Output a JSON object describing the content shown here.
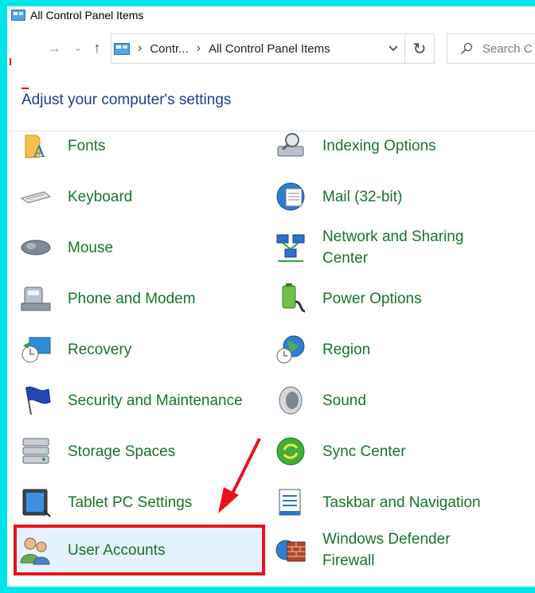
{
  "window": {
    "title": "All Control Panel Items"
  },
  "address_bar": {
    "crumbs": [
      "Contr...",
      "All Control Panel Items"
    ]
  },
  "search": {
    "placeholder": "Search C"
  },
  "heading": "Adjust your computer's settings",
  "items_left": [
    {
      "label": "Fonts",
      "icon": "fonts-icon"
    },
    {
      "label": "Keyboard",
      "icon": "keyboard-icon"
    },
    {
      "label": "Mouse",
      "icon": "mouse-icon"
    },
    {
      "label": "Phone and Modem",
      "icon": "phone-modem-icon"
    },
    {
      "label": "Recovery",
      "icon": "recovery-icon"
    },
    {
      "label": "Security and Maintenance",
      "icon": "security-flag-icon"
    },
    {
      "label": "Storage Spaces",
      "icon": "storage-spaces-icon"
    },
    {
      "label": "Tablet PC Settings",
      "icon": "tablet-pc-icon"
    },
    {
      "label": "User Accounts",
      "icon": "user-accounts-icon"
    }
  ],
  "items_right": [
    {
      "label": "Indexing Options",
      "icon": "indexing-icon"
    },
    {
      "label": "Mail (32-bit)",
      "icon": "mail-icon"
    },
    {
      "label_line1": "Network and Sharing",
      "label_line2": "Center",
      "icon": "network-icon"
    },
    {
      "label": "Power Options",
      "icon": "power-icon"
    },
    {
      "label": "Region",
      "icon": "region-globe-icon"
    },
    {
      "label": "Sound",
      "icon": "sound-speaker-icon"
    },
    {
      "label": "Sync Center",
      "icon": "sync-center-icon"
    },
    {
      "label": "Taskbar and Navigation",
      "icon": "taskbar-icon"
    },
    {
      "label_line1": "Windows Defender",
      "label_line2": "Firewall",
      "icon": "firewall-icon"
    }
  ],
  "colors": {
    "link_green": "#17742c",
    "heading_blue": "#1e3d99",
    "highlight_border": "#e8141b",
    "frame": "#00e5ea"
  }
}
